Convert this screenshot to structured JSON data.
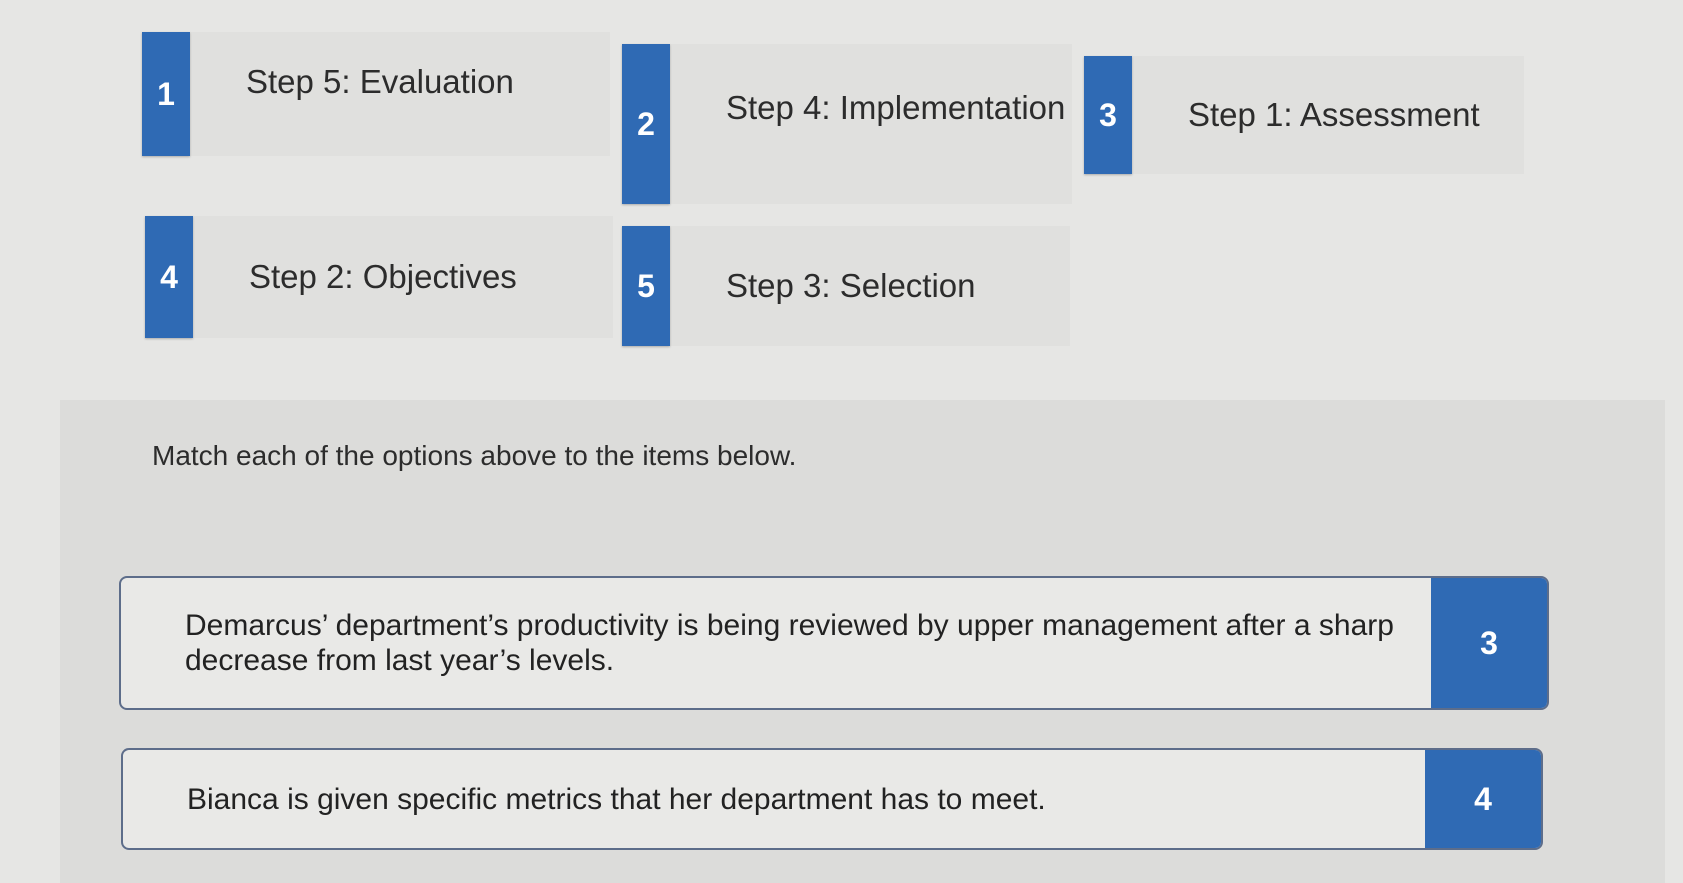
{
  "options": [
    {
      "number": "1",
      "label": "Step 5: Evaluation"
    },
    {
      "number": "2",
      "label": "Step 4: Implementation"
    },
    {
      "number": "3",
      "label": "Step 1: Assessment"
    },
    {
      "number": "4",
      "label": "Step 2: Objectives"
    },
    {
      "number": "5",
      "label": "Step 3: Selection"
    }
  ],
  "instructions": "Match each of the options above to the items below.",
  "items": [
    {
      "text": "Demarcus’ department’s productivity is being reviewed by upper management after a sharp decrease from last year’s levels.",
      "answer": "3"
    },
    {
      "text": "Bianca is given specific metrics that her department has to meet.",
      "answer": "4"
    }
  ],
  "colors": {
    "accent": "#2f6ab4",
    "item_border": "#5d6d8a"
  }
}
